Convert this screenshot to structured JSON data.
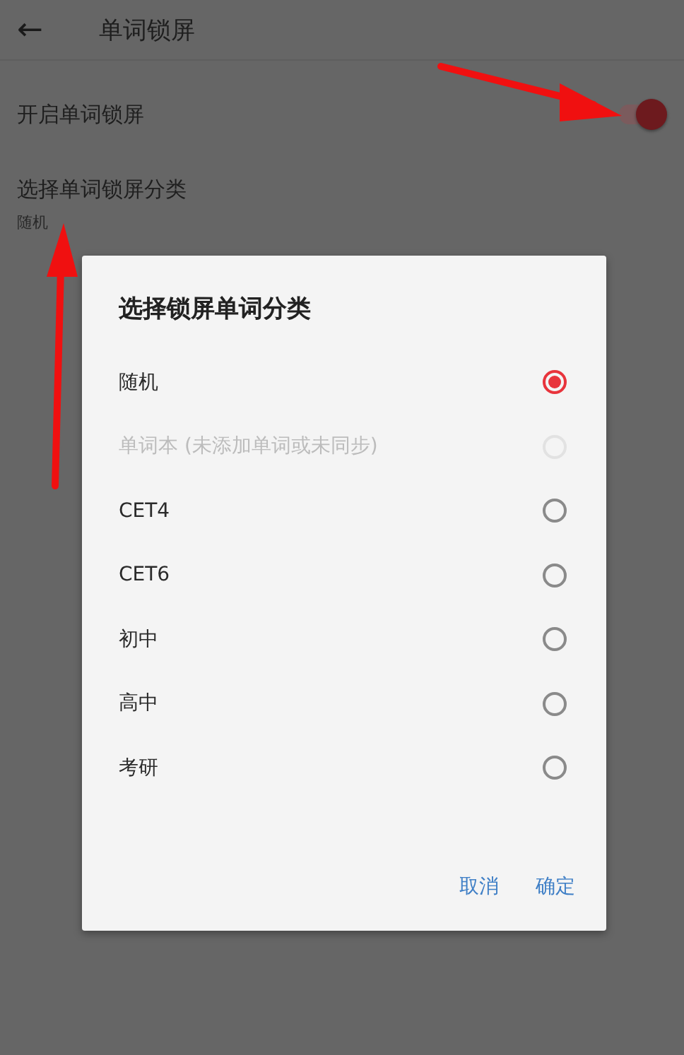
{
  "header": {
    "back_icon": "←",
    "title": "单词锁屏"
  },
  "settings": [
    {
      "kind": "switch",
      "label": "开启单词锁屏",
      "on": true
    },
    {
      "kind": "choice",
      "label": "选择单词锁屏分类",
      "value": "随机"
    }
  ],
  "dialog": {
    "title": "选择锁屏单词分类",
    "options": [
      {
        "label": "随机",
        "selected": true,
        "disabled": false
      },
      {
        "label": "单词本 (未添加单词或未同步)",
        "selected": false,
        "disabled": true
      },
      {
        "label": "CET4",
        "selected": false,
        "disabled": false
      },
      {
        "label": "CET6",
        "selected": false,
        "disabled": false
      },
      {
        "label": "初中",
        "selected": false,
        "disabled": false
      },
      {
        "label": "高中",
        "selected": false,
        "disabled": false
      },
      {
        "label": "考研",
        "selected": false,
        "disabled": false
      }
    ],
    "buttons": [
      "取消",
      "确定"
    ]
  }
}
